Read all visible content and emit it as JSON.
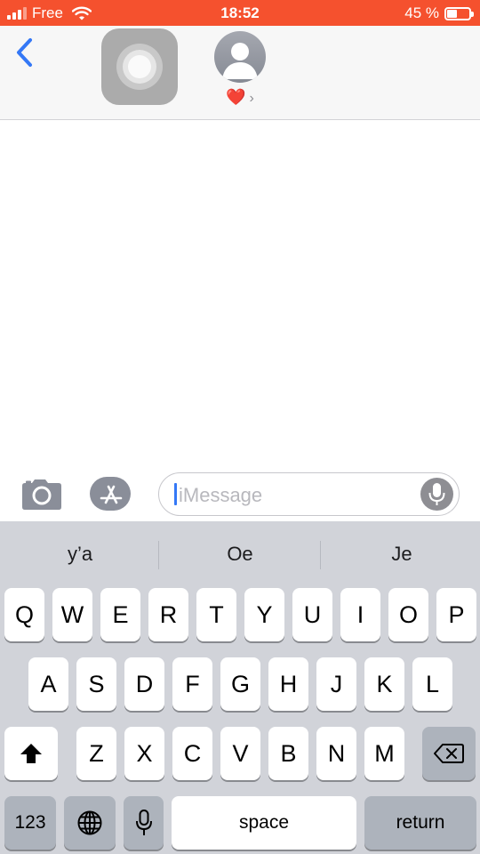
{
  "status_bar": {
    "carrier": "Free",
    "time": "18:52",
    "battery_percent": "45 %",
    "battery_level": 0.45,
    "background_color": "#f5512e"
  },
  "header": {
    "back_icon": "chevron-left-icon",
    "contact_name": "❤️",
    "contact_chevron": "›",
    "avatar_icon": "person-silhouette-icon"
  },
  "input_bar": {
    "camera_icon": "camera-icon",
    "appstore_icon": "app-store-icon",
    "message_placeholder": "iMessage",
    "dictation_icon": "microphone-icon"
  },
  "keyboard": {
    "suggestions": [
      "y’a",
      "Oe",
      "Je"
    ],
    "row1": [
      "Q",
      "W",
      "E",
      "R",
      "T",
      "Y",
      "U",
      "I",
      "O",
      "P"
    ],
    "row2": [
      "A",
      "S",
      "D",
      "F",
      "G",
      "H",
      "J",
      "K",
      "L"
    ],
    "row3": [
      "Z",
      "X",
      "C",
      "V",
      "B",
      "N",
      "M"
    ],
    "numbers_label": "123",
    "space_label": "space",
    "return_label": "return",
    "shift_icon": "shift-icon",
    "delete_icon": "delete-backspace-icon",
    "globe_icon": "globe-icon",
    "mic_icon": "microphone-icon"
  },
  "colors": {
    "accent_blue": "#3478f6",
    "keyboard_bg": "#d1d3d9",
    "key_dark": "#adb3bc"
  }
}
